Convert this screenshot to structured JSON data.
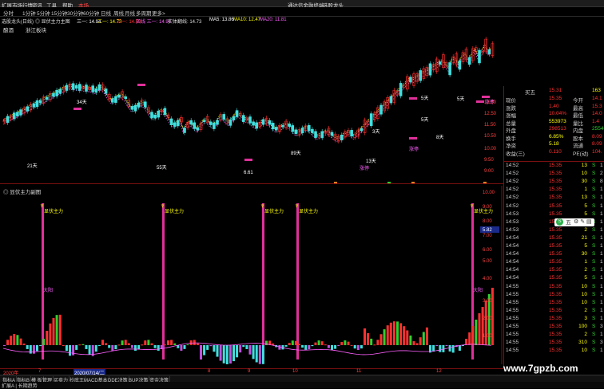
{
  "menu": {
    "items": [
      "扩展市场行情",
      "资讯",
      "工具",
      "帮助",
      "本场"
    ],
    "right_link": "通达信金融终端",
    "right_label": "选股龙头"
  },
  "periods": [
    "分时",
    "1分钟",
    "5分钟",
    "15分钟",
    "30分钟",
    "60分钟",
    "日线",
    "周线",
    "月线",
    "多周期",
    "更多>"
  ],
  "info_line": {
    "prefix": "选股龙头(日线)",
    "indicator": "◎ 显伏主力主图",
    "i1": "三一: 14.94",
    "i2": "二一: 14.73",
    "i3": "三一: 14.53",
    "i4": "买线 三一: 14.94",
    "i5": "实体翻线: 14.73",
    "ma5": "MA5: 13.86",
    "ma10": "MA10: 12.47",
    "ma20": "MA20: 11.81"
  },
  "stock_row": {
    "name": "酿酒",
    "sector": "浙江板块"
  },
  "main_annotations": [
    "34天",
    "21天",
    "55天",
    "89天",
    "6.61",
    "5天",
    "3天",
    "13天",
    "5天",
    "8天",
    "5天",
    "涨停",
    "涨停",
    "涨停"
  ],
  "ind_title": "◎ 显伏主力副图",
  "signal_label": "显伏主力",
  "yang_label": "大阳",
  "main_axis": [
    "13.50",
    "12.50",
    "11.50",
    "10.50",
    "10.00",
    "9.50",
    "9.00"
  ],
  "ind_axis": [
    "10.00",
    "9.00",
    "8.00",
    "7.00",
    "6.00",
    "5.82",
    "5.00",
    "4.00",
    "3.00",
    "2.00",
    "1.00"
  ],
  "ind_axis_highlight": "5.82",
  "dates": [
    {
      "label": "2020年",
      "hl": false
    },
    {
      "label": "7",
      "hl": false
    },
    {
      "label": "2020/07/14/二",
      "hl": true
    },
    {
      "label": "8",
      "hl": false
    },
    {
      "label": "9",
      "hl": false
    },
    {
      "label": "10",
      "hl": false
    },
    {
      "label": "11",
      "hl": false
    },
    {
      "label": "12",
      "hl": false
    }
  ],
  "tabs": [
    "指标A",
    "指标B",
    "模 板",
    "管理",
    "买卖力",
    "抄底王",
    "MACD基本",
    "DDE决策",
    "BUP决策",
    "资金决策"
  ],
  "status": "扩展A | 长期趋势",
  "quote": {
    "top_label": "买五",
    "top_price": "15.31",
    "top_vol": "163",
    "rows": [
      {
        "l1": "现价",
        "v1": "15.35",
        "l2": "今开",
        "v2": "14.1"
      },
      {
        "l1": "涨跌",
        "v1": "1.40",
        "l2": "最高",
        "v2": "15.3"
      },
      {
        "l1": "涨幅",
        "v1": "10.04%",
        "l2": "最低",
        "v2": "14.0"
      },
      {
        "l1": "总量",
        "v1": "553973",
        "l2": "量比",
        "v2": "1.4"
      },
      {
        "l1": "外盘",
        "v1": "298513",
        "l2": "内盘",
        "v2": "25546"
      },
      {
        "l1": "换手",
        "v1": "6.85%",
        "l2": "股本",
        "v2": "8.09"
      },
      {
        "l1": "净资",
        "v1": "5.18",
        "l2": "流通",
        "v2": "8.09"
      },
      {
        "l1": "收益(三)",
        "v1": "0.110",
        "l2": "PE(动)",
        "v2": "104."
      }
    ]
  },
  "ticks": [
    {
      "t": "14:52",
      "p": "15.35",
      "v": "13",
      "d": "S",
      "n": "1"
    },
    {
      "t": "14:52",
      "p": "15.35",
      "v": "10",
      "d": "S",
      "n": "2"
    },
    {
      "t": "14:52",
      "p": "15.35",
      "v": "30",
      "d": "S",
      "n": "8"
    },
    {
      "t": "14:52",
      "p": "15.35",
      "v": "1",
      "d": "S",
      "n": "1"
    },
    {
      "t": "14:52",
      "p": "15.35",
      "v": "13",
      "d": "S",
      "n": "1"
    },
    {
      "t": "14:52",
      "p": "15.35",
      "v": "5",
      "d": "S",
      "n": "1"
    },
    {
      "t": "14:53",
      "p": "15.35",
      "v": "5",
      "d": "S",
      "n": "1"
    },
    {
      "t": "14:53",
      "p": "15.35",
      "v": "1",
      "d": "S",
      "n": "1"
    },
    {
      "t": "14:53",
      "p": "15.35",
      "v": "2",
      "d": "S",
      "n": "1"
    },
    {
      "t": "14:54",
      "p": "15.35",
      "v": "21",
      "d": "S",
      "n": "1"
    },
    {
      "t": "14:54",
      "p": "15.35",
      "v": "5",
      "d": "S",
      "n": "1"
    },
    {
      "t": "14:54",
      "p": "15.35",
      "v": "30",
      "d": "S",
      "n": "1"
    },
    {
      "t": "14:54",
      "p": "15.35",
      "v": "1",
      "d": "S",
      "n": "1"
    },
    {
      "t": "14:54",
      "p": "15.35",
      "v": "2",
      "d": "S",
      "n": "1"
    },
    {
      "t": "14:54",
      "p": "15.35",
      "v": "5",
      "d": "S",
      "n": "1"
    },
    {
      "t": "14:55",
      "p": "15.35",
      "v": "10",
      "d": "S",
      "n": "1"
    },
    {
      "t": "14:55",
      "p": "15.35",
      "v": "10",
      "d": "S",
      "n": "1"
    },
    {
      "t": "14:55",
      "p": "15.35",
      "v": "10",
      "d": "S",
      "n": "1"
    },
    {
      "t": "14:55",
      "p": "15.35",
      "v": "2",
      "d": "S",
      "n": "1"
    },
    {
      "t": "14:55",
      "p": "15.35",
      "v": "3",
      "d": "S",
      "n": "1"
    },
    {
      "t": "14:55",
      "p": "15.35",
      "v": "100",
      "d": "S",
      "n": "3"
    },
    {
      "t": "14:55",
      "p": "15.35",
      "v": "2",
      "d": "S",
      "n": "1"
    },
    {
      "t": "14:55",
      "p": "15.35",
      "v": "310",
      "d": "S",
      "n": "3"
    },
    {
      "t": "14:55",
      "p": "15.35",
      "v": "10",
      "d": "S",
      "n": "1"
    }
  ],
  "ime_label": "五",
  "watermark": "www.7gpzb.com",
  "colors": {
    "up": "#ff3030",
    "down": "#40e0e0",
    "signal": "#e0309a",
    "accent": "#ffff00",
    "green": "#30d030"
  }
}
